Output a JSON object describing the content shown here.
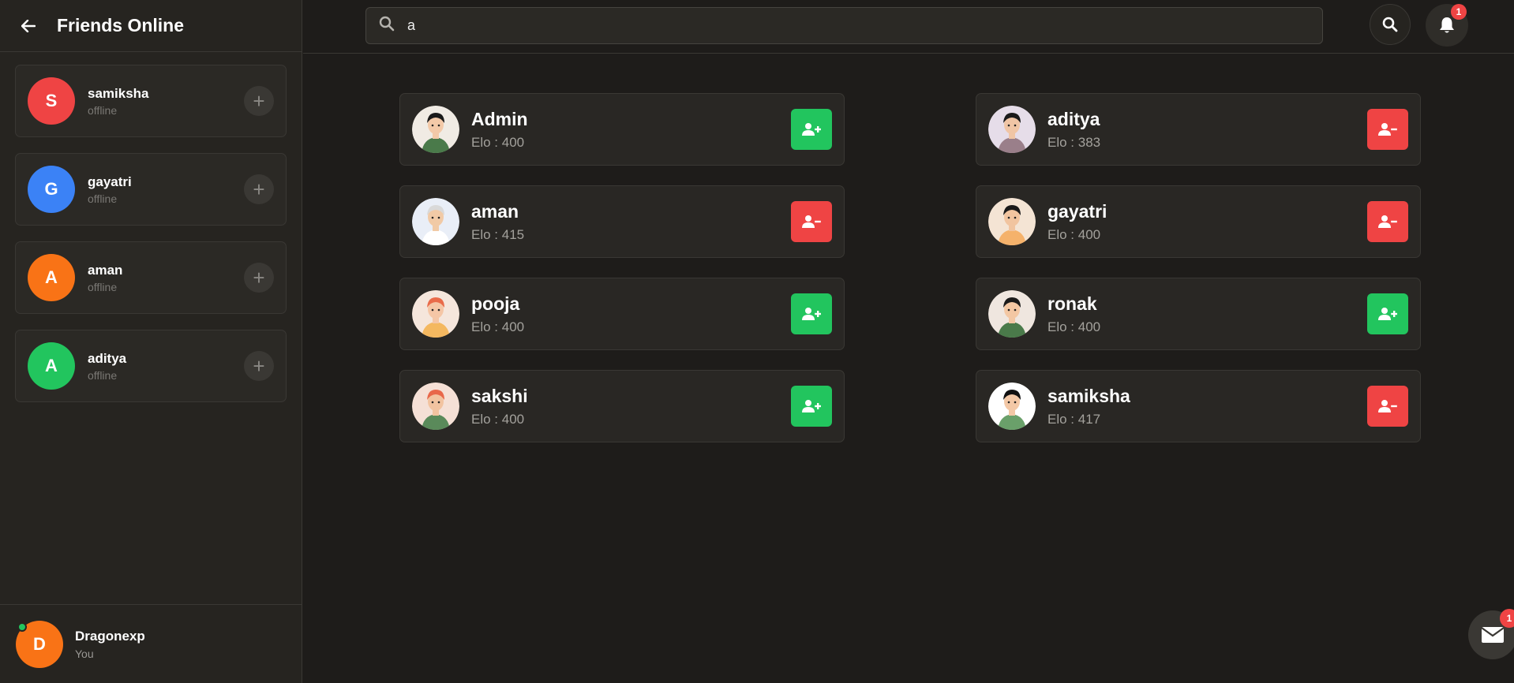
{
  "sidebar": {
    "title": "Friends Online",
    "friends": [
      {
        "initial": "S",
        "name": "samiksha",
        "status": "offline",
        "color": "#ef4444"
      },
      {
        "initial": "G",
        "name": "gayatri",
        "status": "offline",
        "color": "#3b82f6"
      },
      {
        "initial": "A",
        "name": "aman",
        "status": "offline",
        "color": "#f97316"
      },
      {
        "initial": "A",
        "name": "aditya",
        "status": "offline",
        "color": "#22c55e"
      }
    ],
    "me": {
      "initial": "D",
      "name": "Dragonexp",
      "sub": "You",
      "color": "#f97316"
    }
  },
  "search": {
    "value": "a"
  },
  "notifications": {
    "bell_count": "1",
    "mail_count": "1"
  },
  "users": [
    {
      "name": "Admin",
      "elo": "Elo : 400",
      "action": "add-friend",
      "icon": "user-plus-icon"
    },
    {
      "name": "aditya",
      "elo": "Elo : 383",
      "action": "remove-friend",
      "icon": "user-minus-icon"
    },
    {
      "name": "aman",
      "elo": "Elo : 415",
      "action": "remove-friend",
      "icon": "user-minus-icon"
    },
    {
      "name": "gayatri",
      "elo": "Elo : 400",
      "action": "remove-friend",
      "icon": "user-minus-icon"
    },
    {
      "name": "pooja",
      "elo": "Elo : 400",
      "action": "add-friend",
      "icon": "user-plus-icon"
    },
    {
      "name": "ronak",
      "elo": "Elo : 400",
      "action": "add-friend",
      "icon": "user-plus-icon"
    },
    {
      "name": "sakshi",
      "elo": "Elo : 400",
      "action": "add-friend",
      "icon": "user-plus-icon"
    },
    {
      "name": "samiksha",
      "elo": "Elo : 417",
      "action": "remove-friend",
      "icon": "user-minus-icon"
    }
  ],
  "colors": {
    "add": "#22c55e",
    "remove": "#ef4444",
    "online": "#22c55e"
  }
}
